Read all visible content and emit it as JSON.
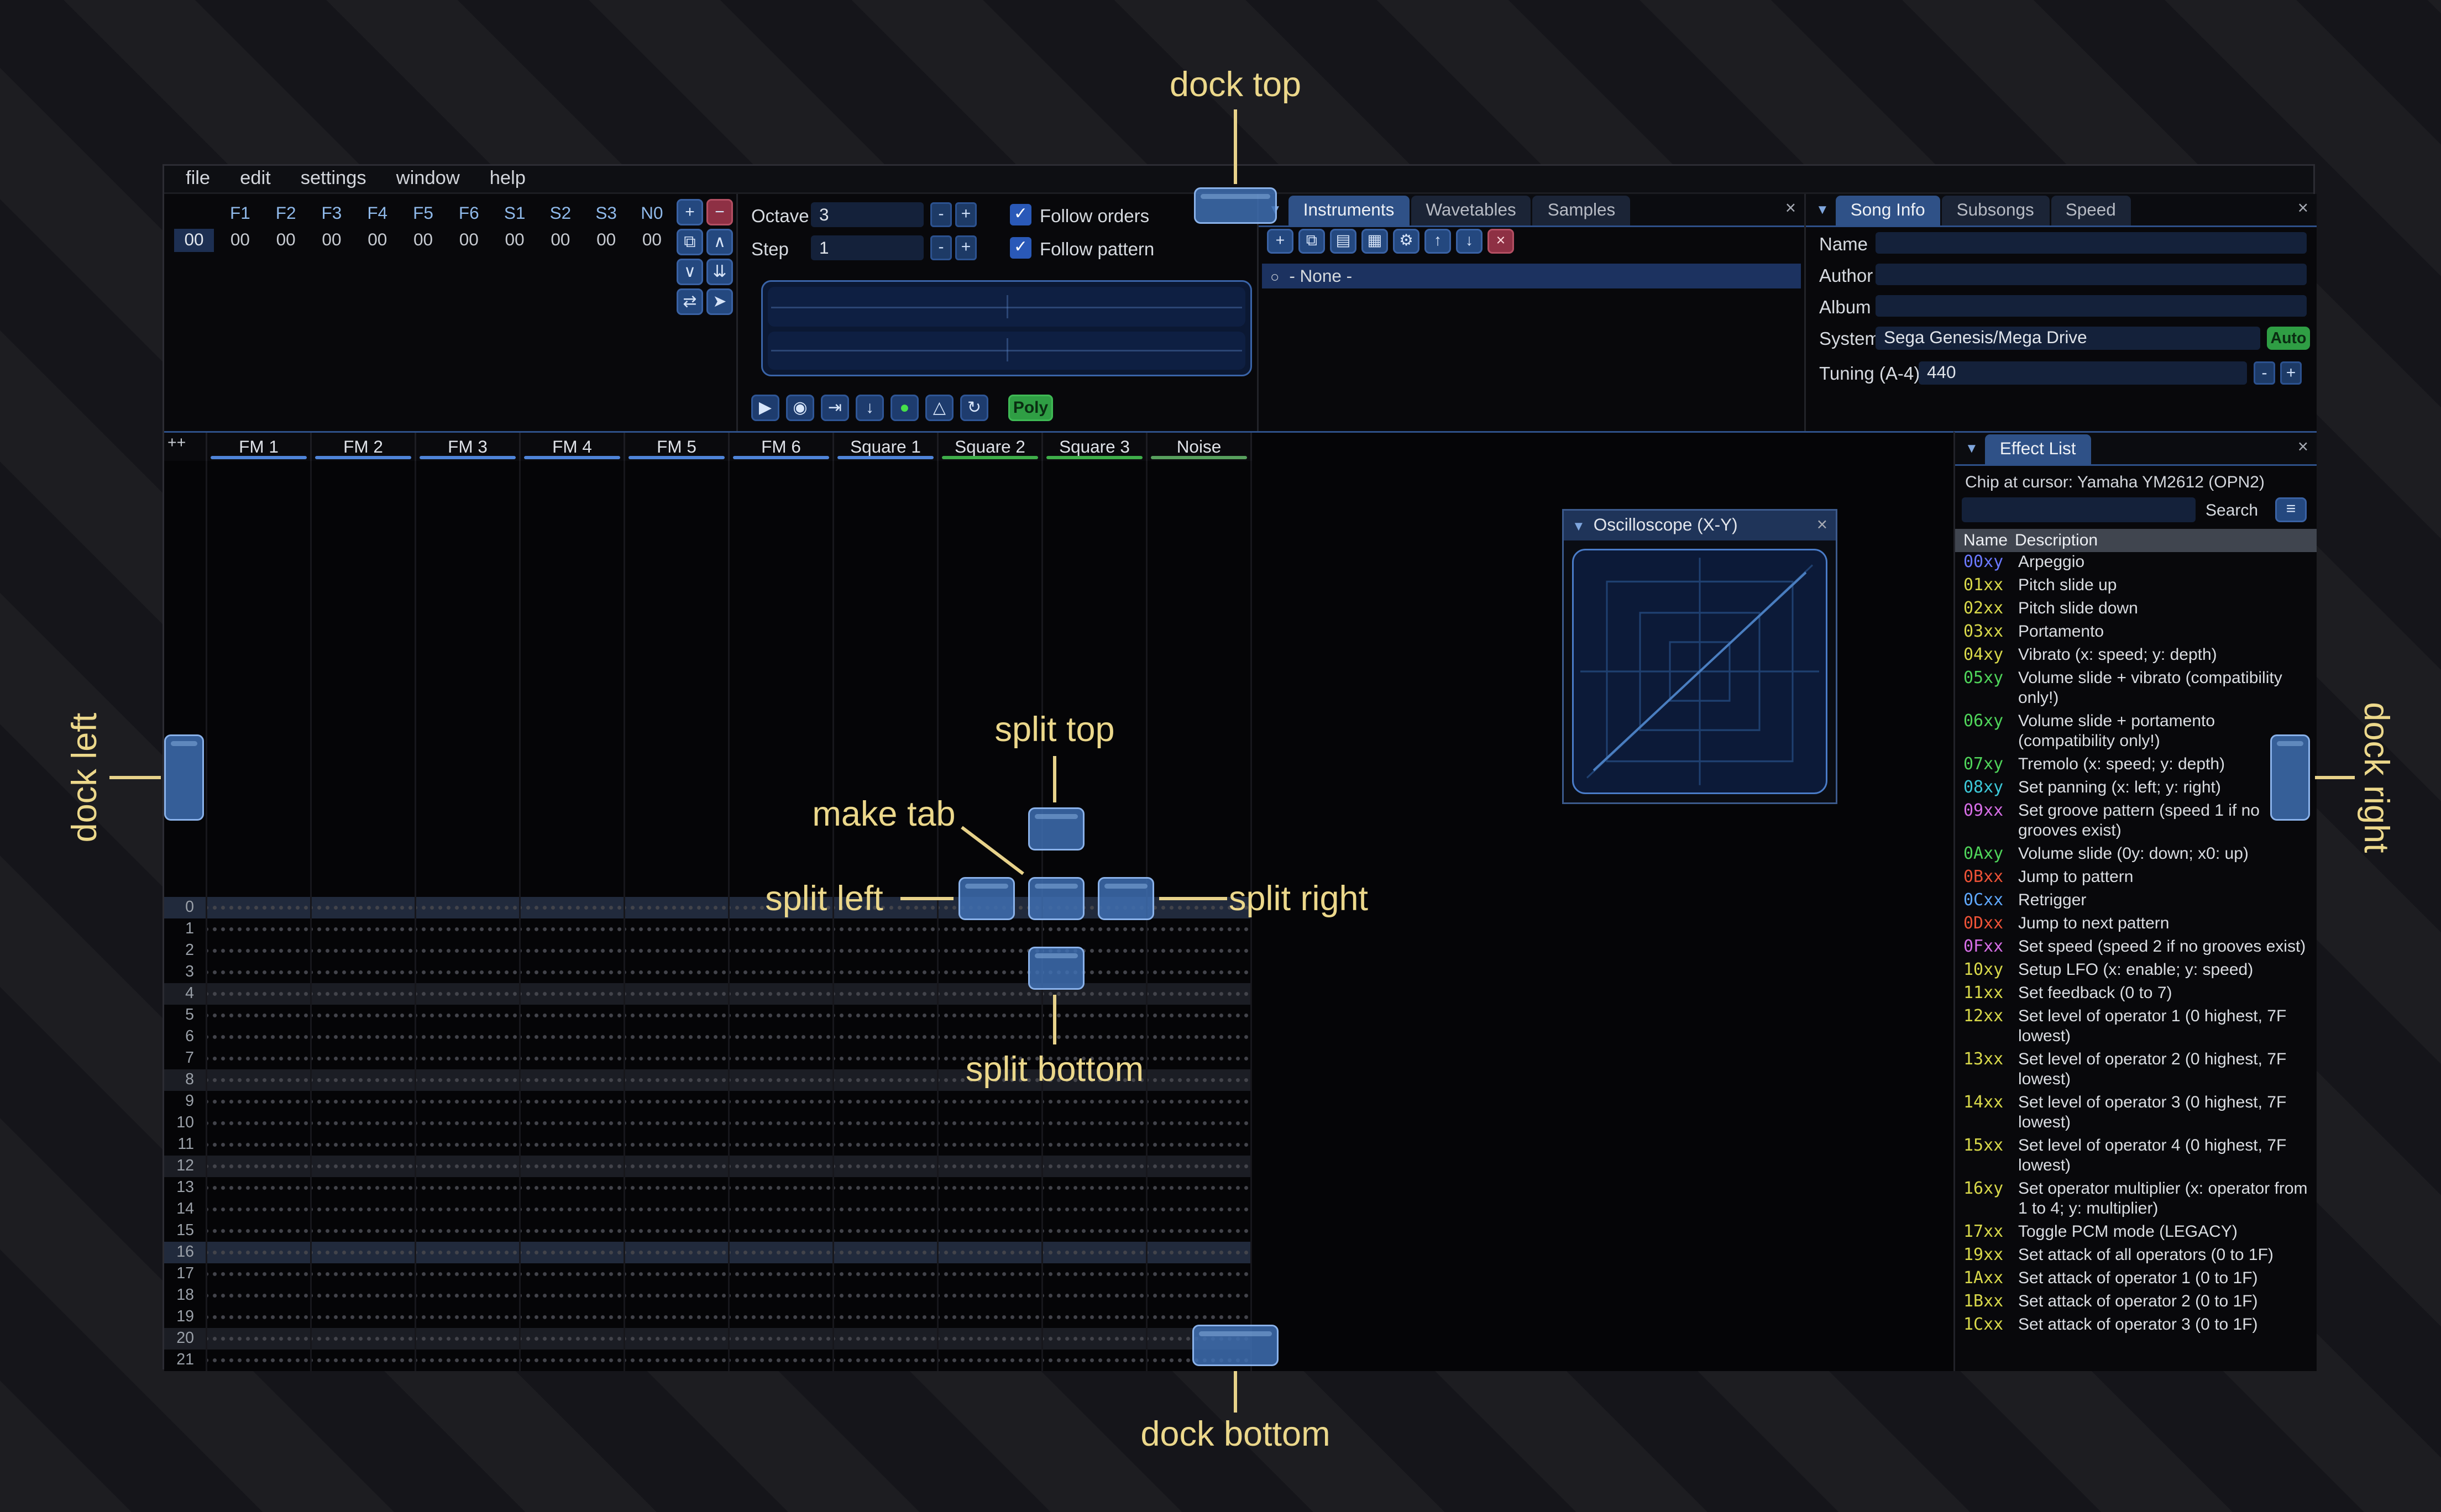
{
  "menu": {
    "items": [
      "file",
      "edit",
      "settings",
      "window",
      "help"
    ]
  },
  "orders": {
    "channel_headers": [
      "F1",
      "F2",
      "F3",
      "F4",
      "F5",
      "F6",
      "S1",
      "S2",
      "S3",
      "N0"
    ],
    "row_index": "00",
    "row_values": [
      "00",
      "00",
      "00",
      "00",
      "00",
      "00",
      "00",
      "00",
      "00",
      "00"
    ],
    "buttons": [
      {
        "name": "add",
        "glyph": "+",
        "danger": false
      },
      {
        "name": "remove",
        "glyph": "−",
        "danger": true
      },
      {
        "name": "duplicate",
        "glyph": "⧉",
        "danger": false
      },
      {
        "name": "move-up",
        "glyph": "∧",
        "danger": false
      },
      {
        "name": "move-down",
        "glyph": "∨",
        "danger": false
      },
      {
        "name": "deep-clone",
        "glyph": "⇊",
        "danger": false
      },
      {
        "name": "change-all",
        "glyph": "⇄",
        "danger": false
      },
      {
        "name": "edit-mode",
        "glyph": "➤",
        "danger": false
      }
    ]
  },
  "controls": {
    "octave_label": "Octave",
    "octave_value": "3",
    "step_label": "Step",
    "step_value": "1",
    "minus": "-",
    "plus": "+",
    "check_glyph": "✓",
    "follow_orders": "Follow orders",
    "follow_pattern": "Follow pattern",
    "transport": [
      {
        "name": "play",
        "glyph": "▶",
        "accent": false
      },
      {
        "name": "play-pattern",
        "glyph": "◉",
        "accent": false
      },
      {
        "name": "step-row",
        "glyph": "⇥",
        "accent": false
      },
      {
        "name": "cursor-follow",
        "glyph": "↓",
        "accent": false
      },
      {
        "name": "record",
        "glyph": "●",
        "accent": true
      },
      {
        "name": "metronome",
        "glyph": "△",
        "accent": false
      },
      {
        "name": "repeat-pattern",
        "glyph": "↻",
        "accent": false
      }
    ],
    "poly_label": "Poly"
  },
  "instruments": {
    "collapse_icon": "▼",
    "tabs": [
      "Instruments",
      "Wavetables",
      "Samples"
    ],
    "close_icon": "×",
    "toolbar": [
      {
        "name": "add",
        "glyph": "+",
        "danger": false
      },
      {
        "name": "duplicate",
        "glyph": "⧉",
        "danger": false
      },
      {
        "name": "open",
        "glyph": "▤",
        "danger": false
      },
      {
        "name": "save",
        "glyph": "▦",
        "danger": false
      },
      {
        "name": "dir-view",
        "glyph": "⚙",
        "danger": false
      },
      {
        "name": "move-up",
        "glyph": "↑",
        "danger": false
      },
      {
        "name": "move-down",
        "glyph": "↓",
        "danger": false
      },
      {
        "name": "delete",
        "glyph": "×",
        "danger": true
      }
    ],
    "selected_radio": "○",
    "selected_item": "- None -"
  },
  "song_info": {
    "collapse_icon": "▼",
    "tabs": [
      "Song Info",
      "Subsongs",
      "Speed"
    ],
    "close_icon": "×",
    "name_label": "Name",
    "name_value": "",
    "author_label": "Author",
    "author_value": "",
    "album_label": "Album",
    "album_value": "",
    "system_label": "System",
    "system_value": "Sega Genesis/Mega Drive",
    "auto_button": "Auto",
    "tuning_label": "Tuning (A-4)",
    "tuning_value": "440",
    "minus": "-",
    "plus": "+"
  },
  "pattern": {
    "corner_button": "++",
    "channels": [
      {
        "name": "FM 1",
        "color": "#4f84d8"
      },
      {
        "name": "FM 2",
        "color": "#4f84d8"
      },
      {
        "name": "FM 3",
        "color": "#4f84d8"
      },
      {
        "name": "FM 4",
        "color": "#4f84d8"
      },
      {
        "name": "FM 5",
        "color": "#4f84d8"
      },
      {
        "name": "FM 6",
        "color": "#4f84d8"
      },
      {
        "name": "Square 1",
        "color": "#4f84d8"
      },
      {
        "name": "Square 2",
        "color": "#3fae4a"
      },
      {
        "name": "Square 3",
        "color": "#3fae4a"
      },
      {
        "name": "Noise",
        "color": "#58a05e"
      }
    ],
    "row_count": 22,
    "highlight_minor": 4,
    "highlight_major": 16
  },
  "oscilloscope": {
    "collapse_icon": "▼",
    "title": "Oscilloscope (X-Y)",
    "close_icon": "×"
  },
  "effect_list": {
    "collapse_icon": "▼",
    "tab": "Effect List",
    "close_icon": "×",
    "chip_label": "Chip at cursor: Yamaha YM2612 (OPN2)",
    "search_label": "Search",
    "search_value": "",
    "menu_icon": "≡",
    "columns": {
      "name": "Name",
      "description": "Description"
    },
    "items": [
      {
        "code": "00xy",
        "color": "#6a78ff",
        "desc": "Arpeggio"
      },
      {
        "code": "01xx",
        "color": "#d8d84a",
        "desc": "Pitch slide up"
      },
      {
        "code": "02xx",
        "color": "#d8d84a",
        "desc": "Pitch slide down"
      },
      {
        "code": "03xx",
        "color": "#d8d84a",
        "desc": "Portamento"
      },
      {
        "code": "04xy",
        "color": "#d8d84a",
        "desc": "Vibrato (x: speed; y: depth)"
      },
      {
        "code": "05xy",
        "color": "#4fd45a",
        "desc": "Volume slide + vibrato (compatibility only!)"
      },
      {
        "code": "06xy",
        "color": "#4fd45a",
        "desc": "Volume slide + portamento (compatibility only!)"
      },
      {
        "code": "07xy",
        "color": "#4fd45a",
        "desc": "Tremolo (x: speed; y: depth)"
      },
      {
        "code": "08xy",
        "color": "#3cc8d8",
        "desc": "Set panning (x: left; y: right)"
      },
      {
        "code": "09xx",
        "color": "#d66ee6",
        "desc": "Set groove pattern (speed 1 if no grooves exist)"
      },
      {
        "code": "0Axy",
        "color": "#4fd45a",
        "desc": "Volume slide (0y: down; x0: up)"
      },
      {
        "code": "0Bxx",
        "color": "#ec5237",
        "desc": "Jump to pattern"
      },
      {
        "code": "0Cxx",
        "color": "#5fa8ff",
        "desc": "Retrigger"
      },
      {
        "code": "0Dxx",
        "color": "#ec5237",
        "desc": "Jump to next pattern"
      },
      {
        "code": "0Fxx",
        "color": "#d66ee6",
        "desc": "Set speed (speed 2 if no grooves exist)"
      },
      {
        "code": "10xy",
        "color": "#d8d84a",
        "desc": "Setup LFO (x: enable; y: speed)"
      },
      {
        "code": "11xx",
        "color": "#d8d84a",
        "desc": "Set feedback (0 to 7)"
      },
      {
        "code": "12xx",
        "color": "#d8d84a",
        "desc": "Set level of operator 1 (0 highest, 7F lowest)"
      },
      {
        "code": "13xx",
        "color": "#d8d84a",
        "desc": "Set level of operator 2 (0 highest, 7F lowest)"
      },
      {
        "code": "14xx",
        "color": "#d8d84a",
        "desc": "Set level of operator 3 (0 highest, 7F lowest)"
      },
      {
        "code": "15xx",
        "color": "#d8d84a",
        "desc": "Set level of operator 4 (0 highest, 7F lowest)"
      },
      {
        "code": "16xy",
        "color": "#d8d84a",
        "desc": "Set operator multiplier (x: operator from 1 to 4; y: multiplier)"
      },
      {
        "code": "17xx",
        "color": "#d8d84a",
        "desc": "Toggle PCM mode (LEGACY)"
      },
      {
        "code": "19xx",
        "color": "#d8d84a",
        "desc": "Set attack of all operators (0 to 1F)"
      },
      {
        "code": "1Axx",
        "color": "#d8d84a",
        "desc": "Set attack of operator 1 (0 to 1F)"
      },
      {
        "code": "1Bxx",
        "color": "#d8d84a",
        "desc": "Set attack of operator 2 (0 to 1F)"
      },
      {
        "code": "1Cxx",
        "color": "#d8d84a",
        "desc": "Set attack of operator 3 (0 to 1F)"
      }
    ]
  },
  "annotations": {
    "dock_top": "dock top",
    "dock_left": "dock left",
    "dock_right": "dock right",
    "dock_bottom": "dock bottom",
    "split_top": "split top",
    "split_left": "split left",
    "split_right": "split right",
    "split_bottom": "split bottom",
    "make_tab": "make tab",
    "color": "#ecd88b"
  },
  "colors": {
    "accent": "#3e6eb2",
    "dock_border": "#8ab2ea",
    "tab_active": "#2f5187",
    "check": "#2a59b8"
  }
}
